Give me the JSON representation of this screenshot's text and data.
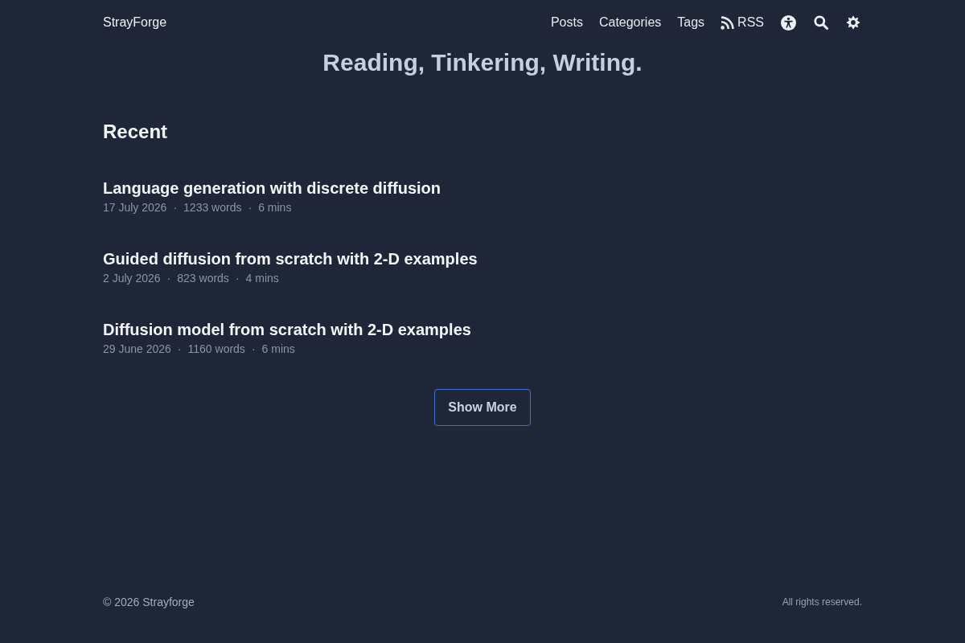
{
  "header": {
    "site_title": "StrayForge",
    "nav": [
      {
        "label": "Posts",
        "kind": "link"
      },
      {
        "label": "Categories",
        "kind": "link"
      },
      {
        "label": "Tags",
        "kind": "link"
      },
      {
        "label": "RSS",
        "kind": "feed"
      }
    ]
  },
  "hero": {
    "title": "Reading, Tinkering, Writing."
  },
  "recent": {
    "heading": "Recent",
    "posts": [
      {
        "title": "Language generation with discrete diffusion",
        "meta": [
          {
            "kind": "text",
            "text": "17 July 2026"
          },
          {
            "kind": "separator",
            "text": "·"
          },
          {
            "kind": "text",
            "text": "1233 words"
          },
          {
            "kind": "separator",
            "text": "·"
          },
          {
            "kind": "text",
            "text": "6 mins"
          }
        ]
      },
      {
        "title": "Guided diffusion from scratch with 2-D examples",
        "meta": [
          {
            "kind": "text",
            "text": "2 July 2026"
          },
          {
            "kind": "separator",
            "text": "·"
          },
          {
            "kind": "text",
            "text": "823 words"
          },
          {
            "kind": "separator",
            "text": "·"
          },
          {
            "kind": "text",
            "text": "4 mins"
          }
        ]
      },
      {
        "title": "Diffusion model from scratch with 2-D examples",
        "meta": [
          {
            "kind": "text",
            "text": "29 June 2026"
          },
          {
            "kind": "separator",
            "text": "·"
          },
          {
            "kind": "text",
            "text": "1160 words"
          },
          {
            "kind": "separator",
            "text": "·"
          },
          {
            "kind": "text",
            "text": "6 mins"
          }
        ]
      }
    ],
    "button": "Show More"
  },
  "footer": {
    "copyright": "© 2026 Strayforge",
    "rights": "All rights reserved."
  }
}
